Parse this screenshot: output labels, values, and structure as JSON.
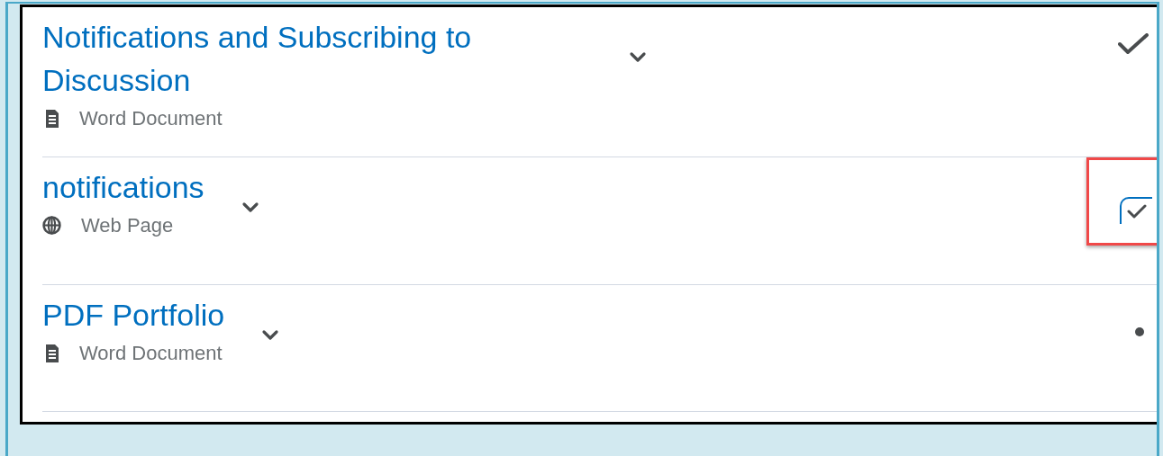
{
  "items": [
    {
      "title": "Notifications and Subscribing to Discussion",
      "kind": "document",
      "type_label": "Word Document",
      "status": {
        "kind": "checkmark"
      },
      "highlighted": false
    },
    {
      "title": "notifications",
      "kind": "web",
      "type_label": "Web Page",
      "status": {
        "kind": "checkbox",
        "checked": true
      },
      "highlighted": true
    },
    {
      "title": "PDF Portfolio",
      "kind": "document",
      "type_label": "Word Document",
      "status": {
        "kind": "dot"
      },
      "highlighted": false
    }
  ]
}
